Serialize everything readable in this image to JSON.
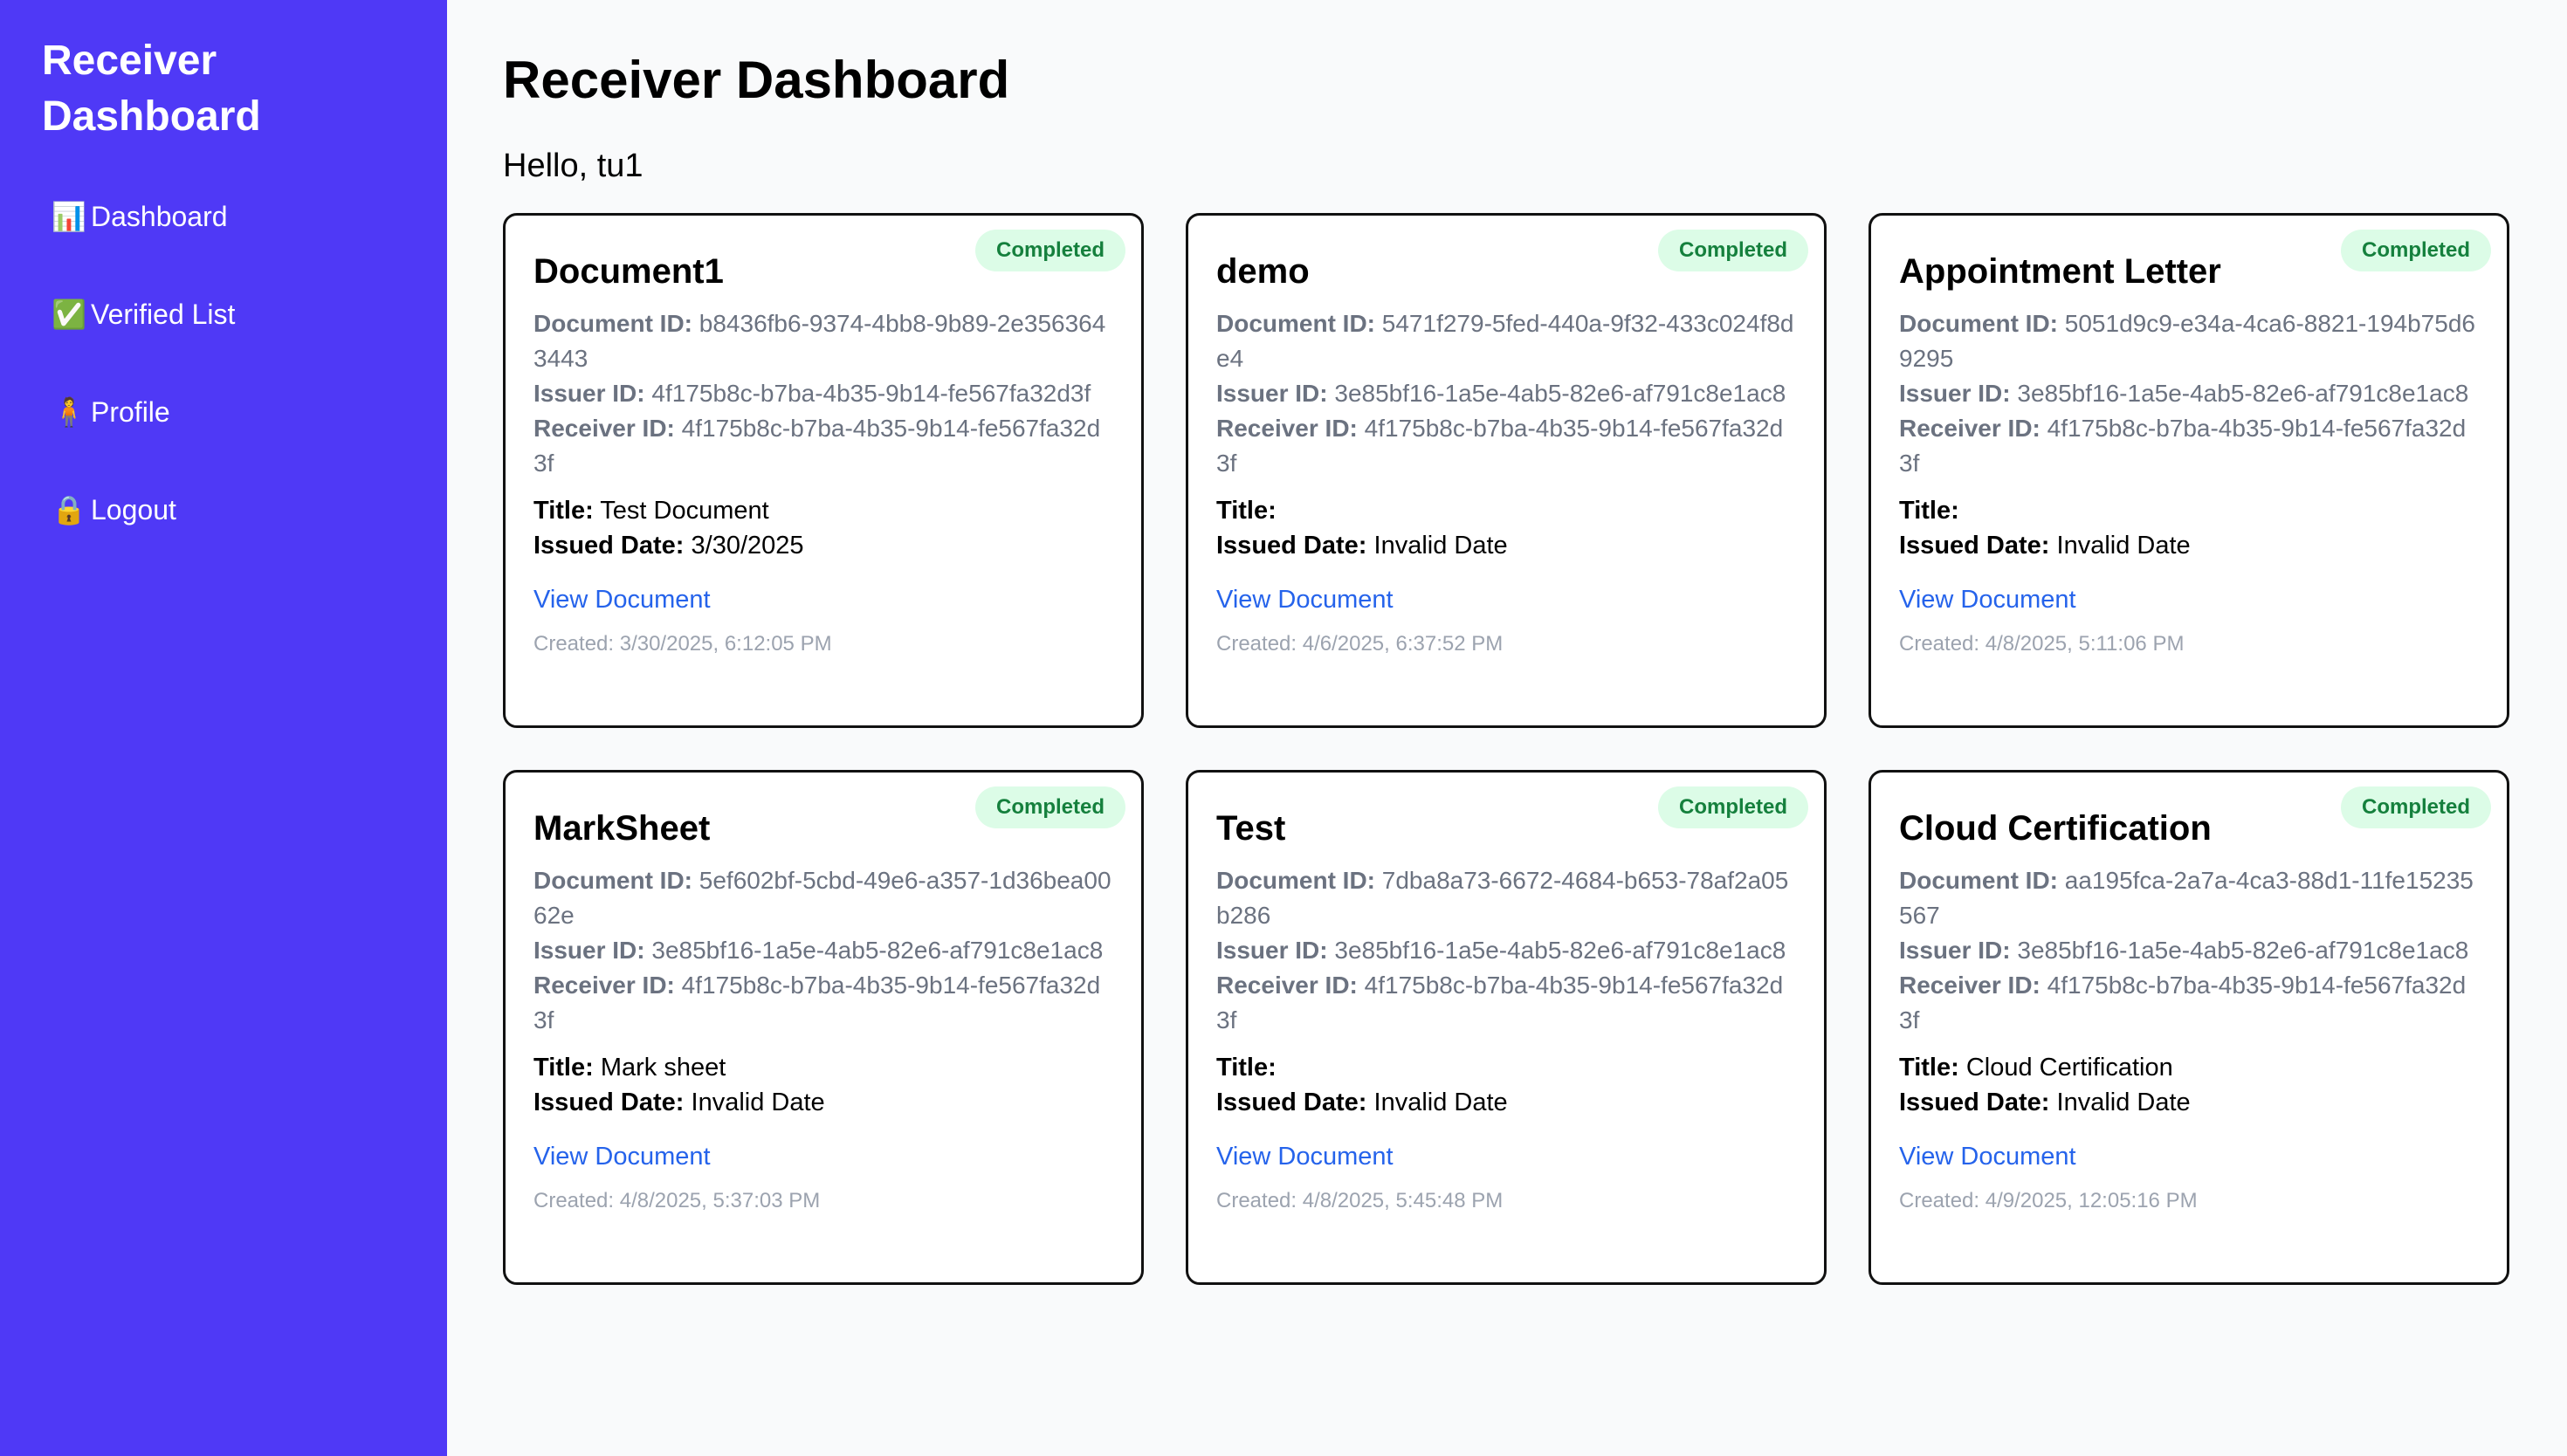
{
  "sidebar": {
    "brand": "Receiver\nDashboard",
    "items": [
      {
        "icon": "chart-icon",
        "glyph": "📊",
        "label": "Dashboard"
      },
      {
        "icon": "check-icon",
        "glyph": "✅",
        "label": "Verified List"
      },
      {
        "icon": "person-icon",
        "glyph": "🧍",
        "label": "Profile"
      },
      {
        "icon": "lock-icon",
        "glyph": "🔒",
        "label": "Logout"
      }
    ]
  },
  "main": {
    "title": "Receiver Dashboard",
    "greeting": "Hello, tu1"
  },
  "labels": {
    "document_id": "Document ID:",
    "issuer_id": "Issuer ID:",
    "receiver_id": "Receiver ID:",
    "title": "Title:",
    "issued_date": "Issued Date:",
    "view": "View Document"
  },
  "cards": [
    {
      "name": "Document1",
      "status": "Completed",
      "document_id": "b8436fb6-9374-4bb8-9b89-2e3563643443",
      "issuer_id": "4f175b8c-b7ba-4b35-9b14-fe567fa32d3f",
      "receiver_id": "4f175b8c-b7ba-4b35-9b14-fe567fa32d3f",
      "title": "Test Document",
      "issued_date": "3/30/2025",
      "created": "Created: 3/30/2025, 6:12:05 PM"
    },
    {
      "name": "demo",
      "status": "Completed",
      "document_id": "5471f279-5fed-440a-9f32-433c024f8de4",
      "issuer_id": "3e85bf16-1a5e-4ab5-82e6-af791c8e1ac8",
      "receiver_id": "4f175b8c-b7ba-4b35-9b14-fe567fa32d3f",
      "title": "",
      "issued_date": "Invalid Date",
      "created": "Created: 4/6/2025, 6:37:52 PM"
    },
    {
      "name": "Appointment Letter",
      "status": "Completed",
      "document_id": "5051d9c9-e34a-4ca6-8821-194b75d69295",
      "issuer_id": "3e85bf16-1a5e-4ab5-82e6-af791c8e1ac8",
      "receiver_id": "4f175b8c-b7ba-4b35-9b14-fe567fa32d3f",
      "title": "",
      "issued_date": "Invalid Date",
      "created": "Created: 4/8/2025, 5:11:06 PM"
    },
    {
      "name": "MarkSheet",
      "status": "Completed",
      "document_id": "5ef602bf-5cbd-49e6-a357-1d36bea0062e",
      "issuer_id": "3e85bf16-1a5e-4ab5-82e6-af791c8e1ac8",
      "receiver_id": "4f175b8c-b7ba-4b35-9b14-fe567fa32d3f",
      "title": "Mark sheet",
      "issued_date": "Invalid Date",
      "created": "Created: 4/8/2025, 5:37:03 PM"
    },
    {
      "name": "Test",
      "status": "Completed",
      "document_id": "7dba8a73-6672-4684-b653-78af2a05b286",
      "issuer_id": "3e85bf16-1a5e-4ab5-82e6-af791c8e1ac8",
      "receiver_id": "4f175b8c-b7ba-4b35-9b14-fe567fa32d3f",
      "title": "",
      "issued_date": "Invalid Date",
      "created": "Created: 4/8/2025, 5:45:48 PM"
    },
    {
      "name": "Cloud Certification",
      "status": "Completed",
      "document_id": "aa195fca-2a7a-4ca3-88d1-11fe15235567",
      "issuer_id": "3e85bf16-1a5e-4ab5-82e6-af791c8e1ac8",
      "receiver_id": "4f175b8c-b7ba-4b35-9b14-fe567fa32d3f",
      "title": "Cloud Certification",
      "issued_date": "Invalid Date",
      "created": "Created: 4/9/2025, 12:05:16 PM"
    }
  ],
  "colors": {
    "sidebar_bg": "#4f39f6",
    "badge_bg": "#dcfce7",
    "badge_text": "#15803d",
    "link": "#2563eb"
  }
}
